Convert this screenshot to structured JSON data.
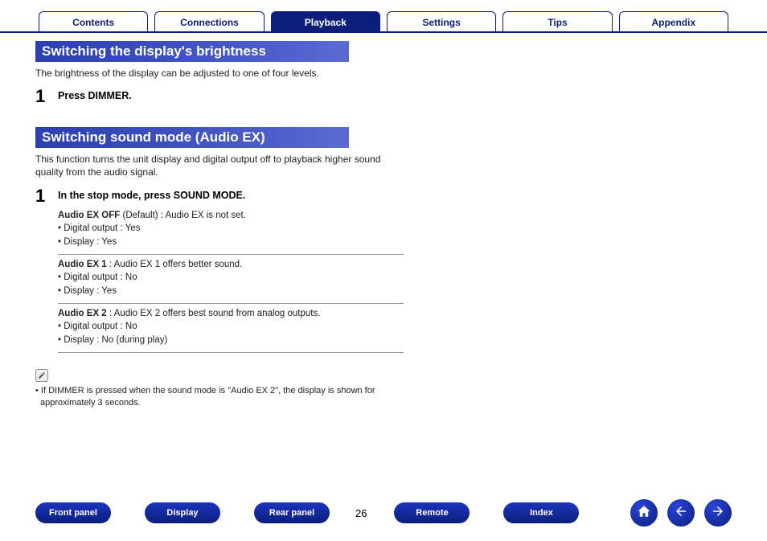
{
  "topTabs": {
    "items": [
      "Contents",
      "Connections",
      "Playback",
      "Settings",
      "Tips",
      "Appendix"
    ],
    "activeIndex": 2
  },
  "section1": {
    "heading": "Switching the display's brightness",
    "intro": "The brightness of the display can be adjusted to one of four levels.",
    "stepNum": "1",
    "stepTitle": "Press DIMMER."
  },
  "section2": {
    "heading": "Switching sound mode (Audio EX)",
    "intro": "This function turns the unit display and digital output off to playback higher sound quality from the audio signal.",
    "stepNum": "1",
    "stepTitle": "In the stop mode, press SOUND MODE.",
    "modes": [
      {
        "label": "Audio EX OFF",
        "suffix": " (Default) : Audio EX is not set.",
        "line1": "• Digital output : Yes",
        "line2": "• Display : Yes"
      },
      {
        "label": "Audio EX 1",
        "suffix": " : Audio EX 1 offers better sound.",
        "line1": "• Digital output : No",
        "line2": "• Display : Yes"
      },
      {
        "label": "Audio EX 2",
        "suffix": " : Audio EX 2 offers best sound from analog outputs.",
        "line1": "• Digital output : No",
        "line2": "• Display : No (during play)"
      }
    ],
    "note": "• If DIMMER is pressed when the sound mode is \"Audio EX 2\", the display is shown for approximately 3 seconds."
  },
  "bottomNav": {
    "pills": [
      "Front panel",
      "Display",
      "Rear panel"
    ],
    "pageNum": "26",
    "pills2": [
      "Remote",
      "Index"
    ]
  }
}
